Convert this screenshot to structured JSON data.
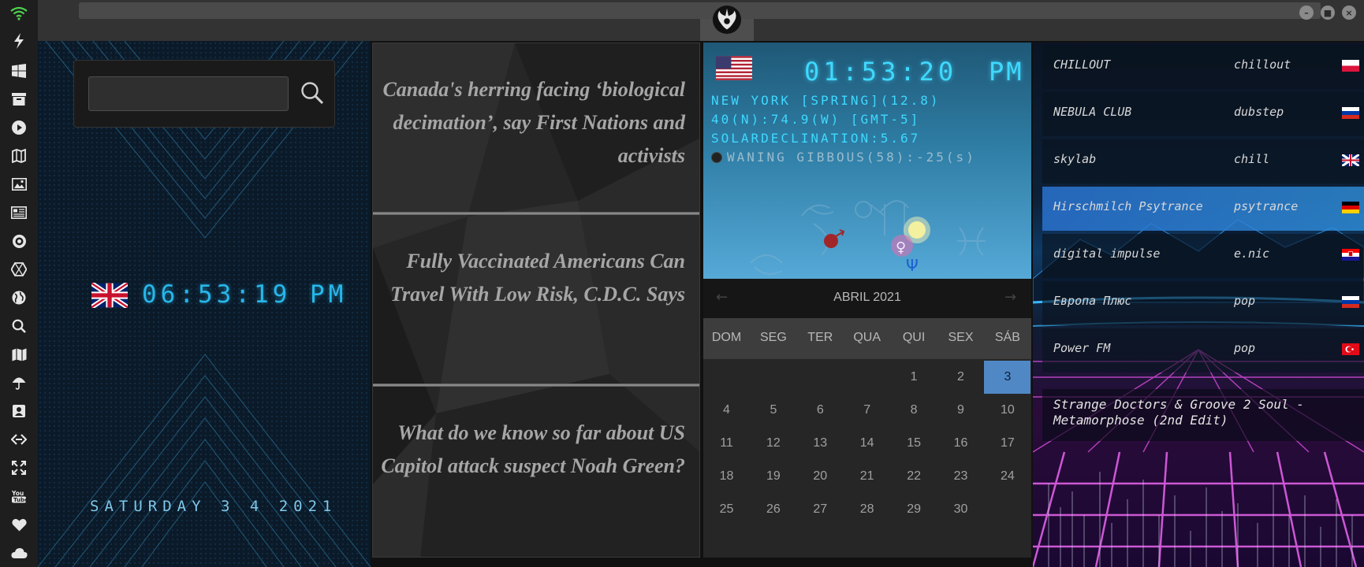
{
  "sidebar": {
    "icons": [
      "wifi-icon",
      "lightning-icon",
      "windows-icon",
      "archive-icon",
      "play-icon",
      "map-book-icon",
      "image-icon",
      "newspaper-icon",
      "settings-gear-icon",
      "hexagon-icon",
      "globe-icon",
      "search-icon",
      "map-icon",
      "umbrella-icon",
      "contacts-icon",
      "code-icon",
      "fullscreen-icon",
      "youtube-icon",
      "heart-icon",
      "cloud-icon"
    ]
  },
  "uk_clock": {
    "search_placeholder": "",
    "time": "06:53:19 PM",
    "date": "SATURDAY 3 4 2021"
  },
  "news": [
    {
      "headline": "Canada's herring facing ‘biological decimation’, say First Nations and activists"
    },
    {
      "headline": "Fully Vaccinated Americans Can Travel With Low Risk, C.D.C. Says"
    },
    {
      "headline": "What do we know so far about US Capitol attack suspect Noah Green?"
    }
  ],
  "ny_clock": {
    "time": "01:53:20",
    "ampm": "PM",
    "line1": "NEW YORK [SPRING](12.8)",
    "line2": "40(N):74.9(W) [GMT-5]",
    "line3": "SOLARDECLINATION:5.67",
    "line4": "WANING GIBBOUS(58):-25(s)"
  },
  "calendar": {
    "month_label": "ABRIL 2021",
    "prev_label": "←",
    "next_label": "→",
    "weekdays": [
      "DOM",
      "SEG",
      "TER",
      "QUA",
      "QUI",
      "SEX",
      "SÁB"
    ],
    "first_weekday_index": 4,
    "days_in_month": 30,
    "today": 3
  },
  "radio": {
    "stations": [
      {
        "name": "CHILLOUT",
        "genre": "chillout",
        "country": "PL"
      },
      {
        "name": "NEBULA CLUB",
        "genre": "dubstep",
        "country": "RU"
      },
      {
        "name": "skylab",
        "genre": "chill",
        "country": "GB"
      },
      {
        "name": "Hirschmilch Psytrance",
        "genre": "psytrance",
        "country": "DE"
      },
      {
        "name": "digital impulse",
        "genre": "e.nic",
        "country": "HR"
      },
      {
        "name": "Европа Плюс",
        "genre": "pop",
        "country": "RU"
      },
      {
        "name": "Power FM",
        "genre": "pop",
        "country": "TR"
      }
    ],
    "highlighted_index": 3,
    "now_playing": "Strange Doctors & Groove 2 Soul - Metamorphose (2nd Edit)"
  },
  "colors": {
    "accent_cyan": "#27b7ea",
    "calendar_today": "#5088c6",
    "radio_highlight": "#2f7fd0"
  }
}
